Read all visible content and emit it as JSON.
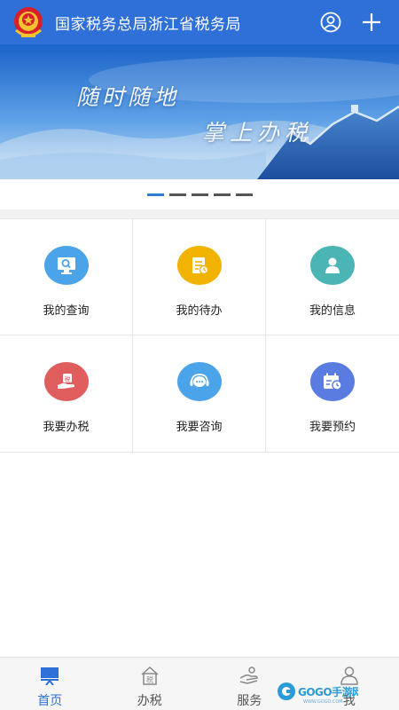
{
  "header": {
    "title": "国家税务总局浙江省税务局",
    "user_icon": "user-circle-icon",
    "add_icon": "plus-icon"
  },
  "banner": {
    "line1": "随时随地",
    "line2": "掌上办税",
    "slide_count": 5,
    "active_slide": 1
  },
  "services": [
    {
      "label": "我的查询",
      "icon": "search-monitor-icon",
      "color": "#4ba3ea"
    },
    {
      "label": "我的待办",
      "icon": "todo-document-icon",
      "color": "#f2b300"
    },
    {
      "label": "我的信息",
      "icon": "person-icon",
      "color": "#4bb4b5"
    },
    {
      "label": "我要办税",
      "icon": "tax-hand-icon",
      "color": "#e05d5d"
    },
    {
      "label": "我要咨询",
      "icon": "chat-headset-icon",
      "color": "#4ba3ea"
    },
    {
      "label": "我要预约",
      "icon": "calendar-clock-icon",
      "color": "#5a7be0"
    }
  ],
  "bottom_nav": {
    "items": [
      {
        "label": "首页",
        "icon": "home-board-icon",
        "active": true
      },
      {
        "label": "办税",
        "icon": "tax-house-icon",
        "active": false
      },
      {
        "label": "服务",
        "icon": "service-hand-icon",
        "active": false
      },
      {
        "label": "我",
        "icon": "me-person-icon",
        "active": false
      }
    ],
    "active_color": "#2f6fd8"
  },
  "watermark": {
    "text": "GOGO手游网",
    "subtext": "WWW.GOGO.COM"
  },
  "colors": {
    "header": "#2f6fd8",
    "accent": "#2f7fd8"
  }
}
